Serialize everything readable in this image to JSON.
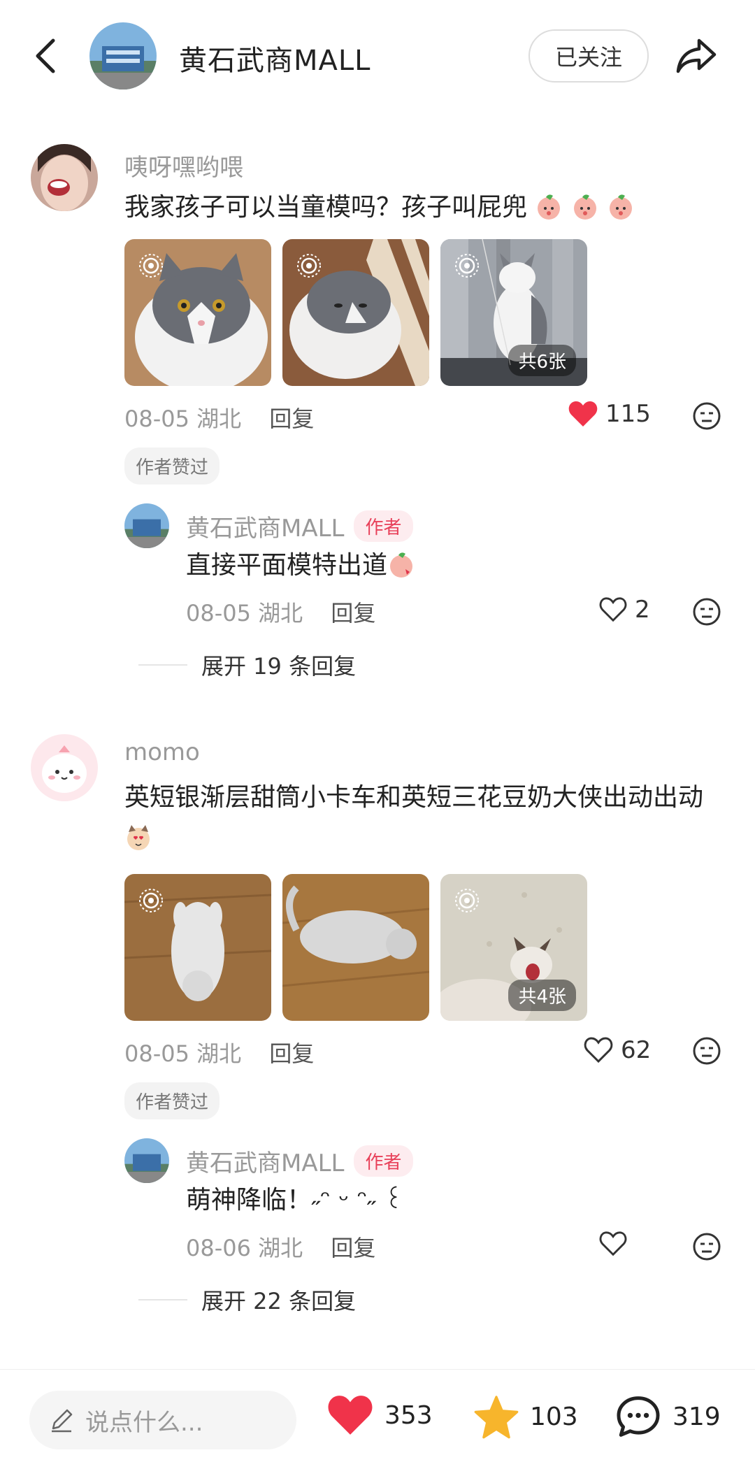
{
  "header": {
    "title": "黄石武商MALL",
    "follow_label": "已关注",
    "back_icon": "chevron-left-icon",
    "share_icon": "share-arrow-icon"
  },
  "comments": [
    {
      "user": "咦呀嘿哟喂",
      "text": "我家孩子可以当童模吗？孩子叫屁兜",
      "image_count": "共6张",
      "date": "08-05",
      "location": "湖北",
      "reply_label": "回复",
      "likes": "115",
      "liked": true,
      "author_liked": "作者赞过",
      "reply": {
        "user": "黄石武商MALL",
        "tag": "作者",
        "text": "直接平面模特出道",
        "date": "08-05",
        "location": "湖北",
        "reply_label": "回复",
        "likes": "2"
      },
      "expand_label": "展开 19 条回复"
    },
    {
      "user": "momo",
      "text": "英短银渐层甜筒小卡车和英短三花豆奶大侠出动出动",
      "image_count": "共4张",
      "date": "08-05",
      "location": "湖北",
      "reply_label": "回复",
      "likes": "62",
      "liked": false,
      "author_liked": "作者赞过",
      "reply": {
        "user": "黄石武商MALL",
        "tag": "作者",
        "text": "萌神降临！˶ᵔ ᵕ ᵔ˶ ꒰",
        "date": "08-06",
        "location": "湖北",
        "reply_label": "回复",
        "likes": ""
      },
      "expand_label": "展开 22 条回复"
    }
  ],
  "bottom_bar": {
    "input_placeholder": "说点什么...",
    "likes": "353",
    "stars": "103",
    "comments": "319"
  },
  "colors": {
    "accent_red": "#f0334a",
    "star_yellow": "#f7b52c",
    "tag_bg": "#fdecef"
  }
}
